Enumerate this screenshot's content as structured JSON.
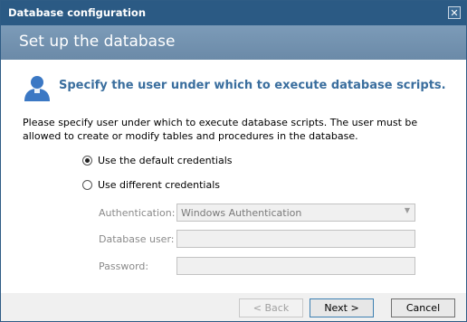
{
  "window": {
    "title": "Database configuration",
    "close_symbol": "✕"
  },
  "header": {
    "title": "Set up the database"
  },
  "section": {
    "title": "Specify the user under which to execute database scripts.",
    "description": "Please specify user under which to execute database scripts. The user must be allowed to create or modify tables and procedures in the database."
  },
  "options": [
    {
      "label": "Use the default credentials",
      "checked": true
    },
    {
      "label": "Use different credentials",
      "checked": false
    }
  ],
  "form": {
    "authentication_label": "Authentication:",
    "authentication_value": "Windows Authentication",
    "database_user_label": "Database user:",
    "database_user_value": "",
    "password_label": "Password:",
    "password_value": ""
  },
  "buttons": {
    "back": "< Back",
    "next": "Next >",
    "cancel": "Cancel"
  },
  "colors": {
    "titlebar": "#2b5a84",
    "header_band": "#7391ae",
    "accent_text": "#3a6e9e",
    "user_icon": "#3b78c4"
  }
}
